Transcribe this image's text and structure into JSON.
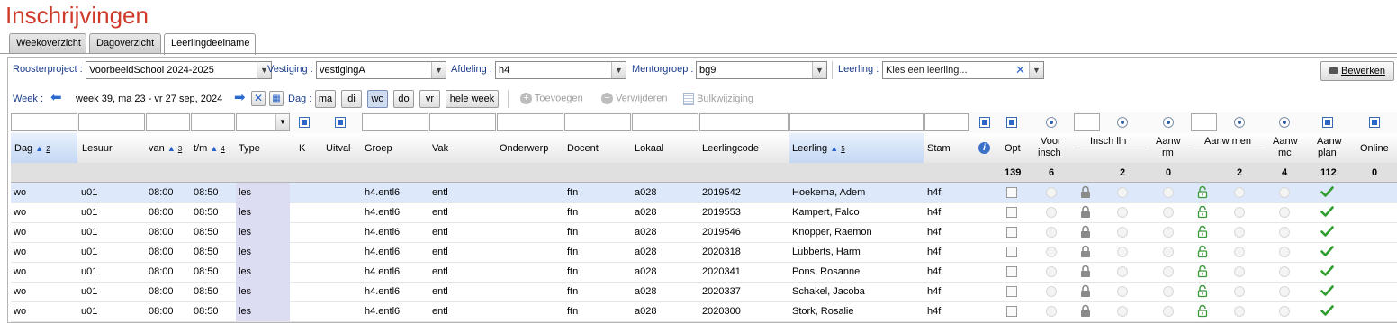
{
  "page": {
    "title": "Inschrijvingen"
  },
  "tabs": [
    "Weekoverzicht",
    "Dagoverzicht",
    "Leerlingdeelname"
  ],
  "filters": {
    "roosterproject_label": "Roosterproject :",
    "roosterproject_value": "VoorbeeldSchool 2024-2025",
    "vestiging_label": "Vestiging :",
    "vestiging_value": "vestigingA",
    "afdeling_label": "Afdeling :",
    "afdeling_value": "h4",
    "mentorgroep_label": "Mentorgroep :",
    "mentorgroep_value": "bg9",
    "leerling_label": "Leerling :",
    "leerling_placeholder": "Kies een leerling...",
    "bewerken_label": "Bewerken"
  },
  "weekbar": {
    "week_label": "Week :",
    "week_value": "week 39, ma 23 - vr 27 sep, 2024",
    "dag_label": "Dag :",
    "days": [
      "ma",
      "di",
      "wo",
      "do",
      "vr"
    ],
    "selected_day": "wo",
    "hele_week": "hele week",
    "toevoegen": "Toevoegen",
    "verwijderen": "Verwijderen",
    "bulkwijziging": "Bulkwijziging"
  },
  "columns": {
    "dag": "Dag",
    "dag_sort": "2",
    "lesuur": "Lesuur",
    "van": "van",
    "van_sort": "3",
    "tm": "t/m",
    "tm_sort": "4",
    "type": "Type",
    "k": "K",
    "uitval": "Uitval",
    "groep": "Groep",
    "vak": "Vak",
    "onderwerp": "Onderwerp",
    "docent": "Docent",
    "lokaal": "Lokaal",
    "leerlingcode": "Leerlingcode",
    "leerling": "Leerling",
    "leerling_sort": "5",
    "stam": "Stam",
    "info": "i",
    "opt": "Opt",
    "voor_insch_1": "Voor",
    "voor_insch_2": "insch",
    "insch_lln": "Insch lln",
    "aanw_rm_1": "Aanw",
    "aanw_rm_2": "rm",
    "aanw_men": "Aanw men",
    "aanw_mc_1": "Aanw",
    "aanw_mc_2": "mc",
    "aanw_plan_1": "Aanw",
    "aanw_plan_2": "plan",
    "online": "Online"
  },
  "summary": {
    "opt": "139",
    "voor_insch": "6",
    "insch_lln": "2",
    "aanw_rm": "0",
    "aanw_men": "2",
    "aanw_mc": "4",
    "aanw_plan": "112",
    "online": "0"
  },
  "rows": [
    {
      "dag": "wo",
      "lesuur": "u01",
      "van": "08:00",
      "tm": "08:50",
      "type": "les",
      "groep": "h4.entl6",
      "vak": "entl",
      "docent": "ftn",
      "lokaal": "a028",
      "code": "2019542",
      "leerling": "Hoekema, Adem",
      "stam": "h4f"
    },
    {
      "dag": "wo",
      "lesuur": "u01",
      "van": "08:00",
      "tm": "08:50",
      "type": "les",
      "groep": "h4.entl6",
      "vak": "entl",
      "docent": "ftn",
      "lokaal": "a028",
      "code": "2019553",
      "leerling": "Kampert, Falco",
      "stam": "h4f"
    },
    {
      "dag": "wo",
      "lesuur": "u01",
      "van": "08:00",
      "tm": "08:50",
      "type": "les",
      "groep": "h4.entl6",
      "vak": "entl",
      "docent": "ftn",
      "lokaal": "a028",
      "code": "2019546",
      "leerling": "Knopper, Raemon",
      "stam": "h4f"
    },
    {
      "dag": "wo",
      "lesuur": "u01",
      "van": "08:00",
      "tm": "08:50",
      "type": "les",
      "groep": "h4.entl6",
      "vak": "entl",
      "docent": "ftn",
      "lokaal": "a028",
      "code": "2020318",
      "leerling": "Lubberts, Harm",
      "stam": "h4f"
    },
    {
      "dag": "wo",
      "lesuur": "u01",
      "van": "08:00",
      "tm": "08:50",
      "type": "les",
      "groep": "h4.entl6",
      "vak": "entl",
      "docent": "ftn",
      "lokaal": "a028",
      "code": "2020341",
      "leerling": "Pons, Rosanne",
      "stam": "h4f"
    },
    {
      "dag": "wo",
      "lesuur": "u01",
      "van": "08:00",
      "tm": "08:50",
      "type": "les",
      "groep": "h4.entl6",
      "vak": "entl",
      "docent": "ftn",
      "lokaal": "a028",
      "code": "2020337",
      "leerling": "Schakel, Jacoba",
      "stam": "h4f"
    },
    {
      "dag": "wo",
      "lesuur": "u01",
      "van": "08:00",
      "tm": "08:50",
      "type": "les",
      "groep": "h4.entl6",
      "vak": "entl",
      "docent": "ftn",
      "lokaal": "a028",
      "code": "2020300",
      "leerling": "Stork, Rosalie",
      "stam": "h4f"
    }
  ],
  "colors": {
    "title": "#d03a2a",
    "label": "#1a3a8a",
    "selected_row": "#dde9fb",
    "type_cell": "#dcdcf2",
    "lock_green": "#3a9a3a",
    "check_green": "#2f9e2f"
  }
}
